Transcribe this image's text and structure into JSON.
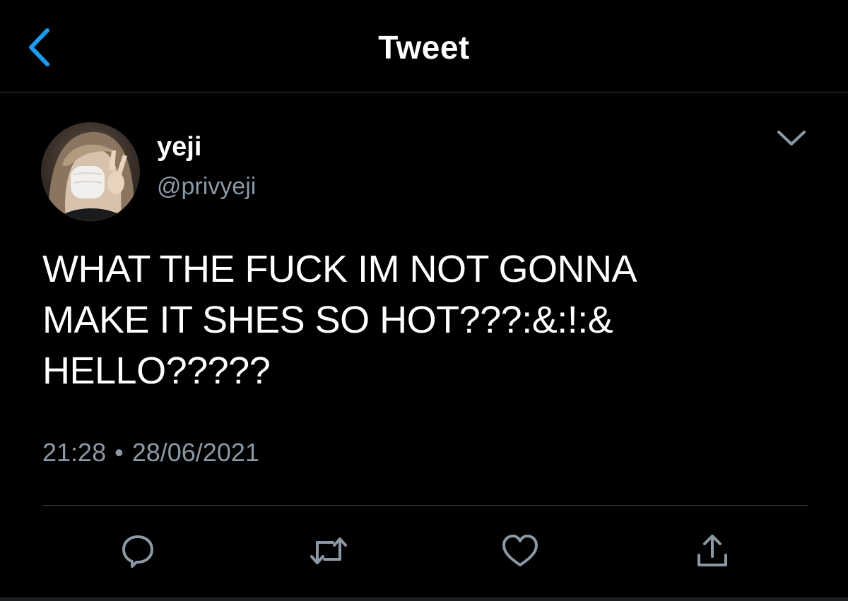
{
  "header": {
    "title": "Tweet",
    "back_icon": "chevron-left-icon",
    "accent_color": "#1d9bf0"
  },
  "tweet": {
    "author": {
      "display_name": "yeji",
      "handle": "@privyeji"
    },
    "text_lines": [
      "WHAT THE FUCK IM NOT GONNA",
      "MAKE IT SHES SO HOT???:&:!:&",
      "HELLO?????"
    ],
    "time": "21:28",
    "separator": "•",
    "date": "28/06/2021",
    "more_icon": "chevron-down-icon"
  },
  "actions": [
    {
      "name": "reply",
      "icon": "reply-icon"
    },
    {
      "name": "retweet",
      "icon": "retweet-icon"
    },
    {
      "name": "like",
      "icon": "heart-icon"
    },
    {
      "name": "share",
      "icon": "share-icon"
    }
  ],
  "colors": {
    "background": "#000000",
    "text": "#ffffff",
    "secondary_text": "#8b98a5",
    "icon": "#8b98a5",
    "divider": "#2f3336"
  }
}
